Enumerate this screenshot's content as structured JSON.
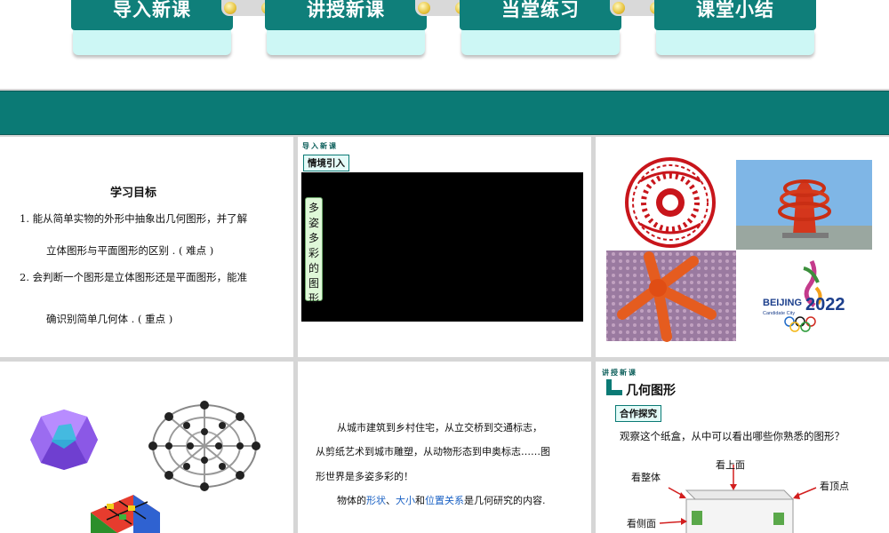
{
  "nav": {
    "tabs": [
      "导入新课",
      "讲授新课",
      "当堂练习",
      "课堂小结"
    ]
  },
  "objectives": {
    "title": "学习目标",
    "item1_line1": "1.  能从简单实物的外形中抽象出几何图形，并了解",
    "item1_line2": "立体图形与平面图形的区别 . ( 难点 )",
    "item2_line1": "2.  会判断一个图形是立体图形还是平面图形，能准",
    "item2_line2": "确识别简单几何体 . ( 重点 )"
  },
  "intro_slide": {
    "section": "导入新课",
    "tag": "情境引入",
    "video_label": "多姿多彩的图形"
  },
  "text_slide": {
    "p1": "从城市建筑到乡村住宅，从立交桥到交通标志，",
    "p2": "从剪纸艺术到城市雕塑，从动物形态到申奥标志……图",
    "p3": "形世界是多姿多彩的！",
    "p4_a": "物体的",
    "p4_shape": "形状",
    "p4_sep1": "、",
    "p4_size": "大小",
    "p4_and": "和",
    "p4_pos": "位置关系",
    "p4_b": "是几何研究的内容."
  },
  "geo_slide": {
    "section": "讲授新课",
    "title": "几何图形",
    "tag": "合作探究",
    "question": "观察这个纸盒，从中可以看出哪些你熟悉的图形？",
    "label_top": "看上面",
    "label_whole": "看整体",
    "label_vertex": "看顶点",
    "label_side": "看侧面"
  },
  "images": {
    "beijing_text": "BEIJING",
    "beijing_sub": "Candidate City",
    "year": "2022"
  },
  "colors": {
    "teal": "#0b7a75",
    "tab_light": "#cdf7f5",
    "highlight": "#1b62c4"
  }
}
